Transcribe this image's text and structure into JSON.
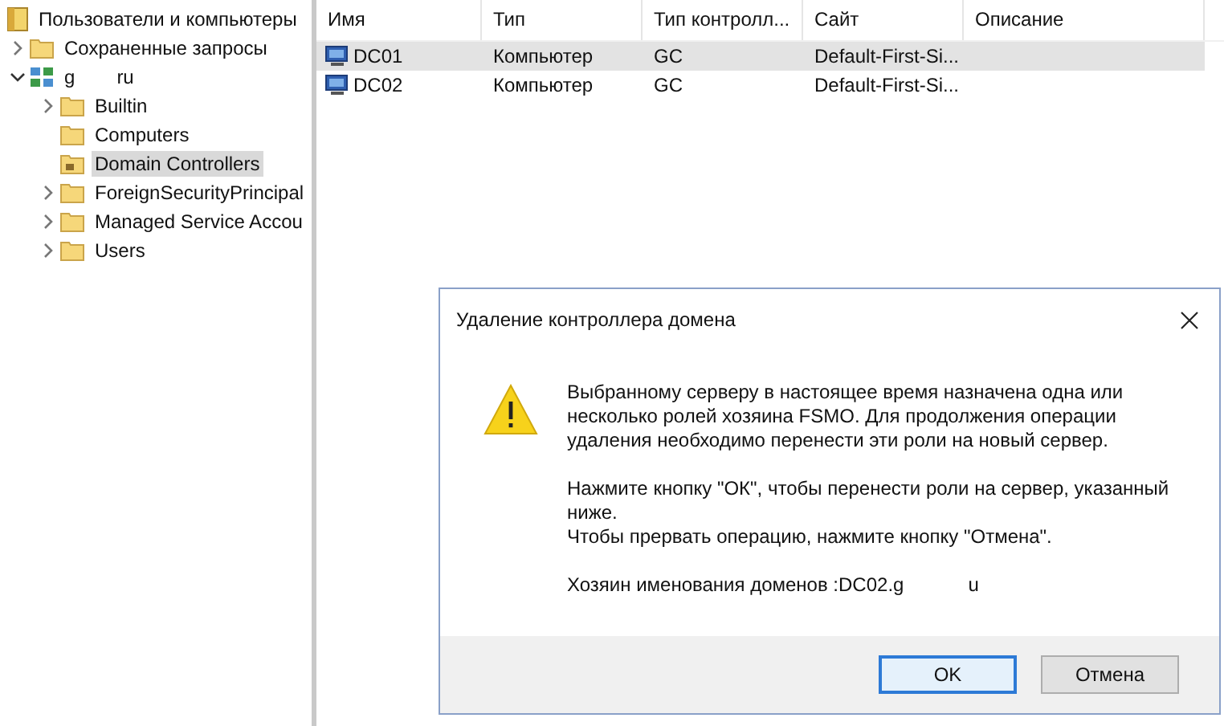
{
  "tree": {
    "root": {
      "label": "Пользователи и компьютеры"
    },
    "items": [
      {
        "label": "Сохраненные запросы",
        "kind": "queries",
        "expandable": true,
        "expanded": false,
        "selected": false
      },
      {
        "label": "g",
        "label_end": "ru",
        "kind": "domain",
        "expandable": true,
        "expanded": true,
        "selected": false,
        "children": [
          {
            "label": "Builtin",
            "kind": "folder",
            "expandable": true,
            "expanded": false,
            "selected": false
          },
          {
            "label": "Computers",
            "kind": "folder",
            "expandable": false,
            "expanded": false,
            "selected": false
          },
          {
            "label": "Domain Controllers",
            "kind": "ou",
            "expandable": false,
            "expanded": false,
            "selected": true
          },
          {
            "label": "ForeignSecurityPrincipal",
            "kind": "folder",
            "expandable": true,
            "expanded": false,
            "selected": false
          },
          {
            "label": "Managed Service Accou",
            "kind": "folder",
            "expandable": true,
            "expanded": false,
            "selected": false
          },
          {
            "label": "Users",
            "kind": "folder",
            "expandable": true,
            "expanded": false,
            "selected": false
          }
        ]
      }
    ]
  },
  "table": {
    "columns": [
      "Имя",
      "Тип",
      "Тип контролл...",
      "Сайт",
      "Описание"
    ],
    "rows": [
      {
        "cells": [
          "DC01",
          "Компьютер",
          "GC",
          "Default-First-Si..."
        ],
        "selected": true
      },
      {
        "cells": [
          "DC02",
          "Компьютер",
          "GC",
          "Default-First-Si..."
        ],
        "selected": false
      }
    ]
  },
  "dialog": {
    "title": "Удаление контроллера домена",
    "paragraphs": [
      "Выбранному серверу в настоящее время назначена одна или несколько ролей хозяина FSMO. Для продолжения операции удаления необходимо перенести эти роли на новый сервер.",
      "Нажмите кнопку \"ОК\", чтобы перенести роли на сервер, указанный ниже.\nЧтобы прервать операцию, нажмите кнопку \"Отмена\"."
    ],
    "owner": {
      "text": "Хозяин именования доменов :DC02.g",
      "text_end": "u"
    },
    "buttons": [
      {
        "label": "OK",
        "default": true
      },
      {
        "label": "Отмена",
        "default": false
      }
    ]
  }
}
